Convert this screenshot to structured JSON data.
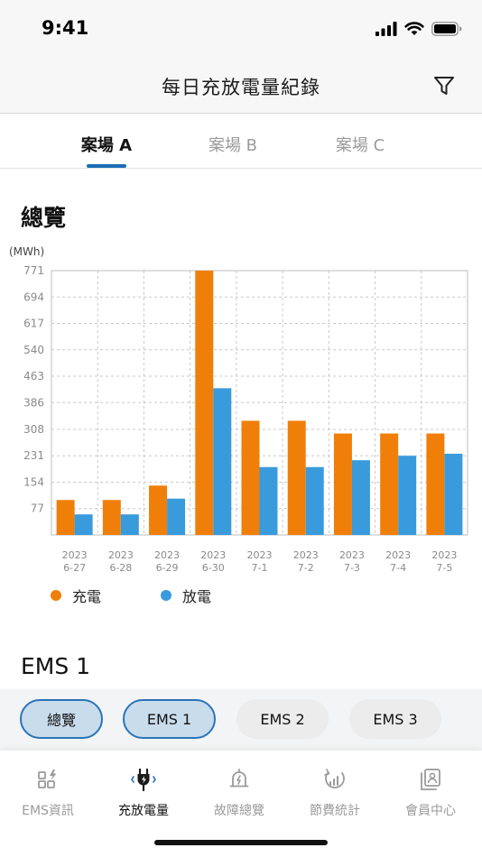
{
  "status_bar": {
    "time": "9:41"
  },
  "nav": {
    "title": "每日充放電量紀錄"
  },
  "site_tabs": [
    {
      "label": "案場 A",
      "active": true
    },
    {
      "label": "案場 B",
      "active": false
    },
    {
      "label": "案場 C",
      "active": false
    }
  ],
  "overview": {
    "title": "總覽"
  },
  "chart_data": {
    "type": "bar",
    "ylabel": "(MWh)",
    "ylim": [
      0,
      771
    ],
    "yticks": [
      "771",
      "694",
      "617",
      "540",
      "463",
      "386",
      "308",
      "231",
      "154",
      "77"
    ],
    "categories": [
      [
        "2023",
        "6-27"
      ],
      [
        "2023",
        "6-28"
      ],
      [
        "2023",
        "6-29"
      ],
      [
        "2023",
        "6-30"
      ],
      [
        "2023",
        "7-1"
      ],
      [
        "2023",
        "7-2"
      ],
      [
        "2023",
        "7-3"
      ],
      [
        "2023",
        "7-4"
      ],
      [
        "2023",
        "7-5"
      ]
    ],
    "series": [
      {
        "name": "充電",
        "color": "#f07f09",
        "values": [
          102,
          102,
          144,
          771,
          333,
          333,
          296,
          296,
          296
        ]
      },
      {
        "name": "放電",
        "color": "#3a9bdc",
        "values": [
          60,
          60,
          106,
          428,
          198,
          198,
          218,
          231,
          237
        ]
      }
    ],
    "grid": true,
    "legend": "bottom-left"
  },
  "ems": {
    "title": "EMS 1",
    "chips": [
      {
        "label": "總覽",
        "selected": true
      },
      {
        "label": "EMS 1",
        "selected": true
      },
      {
        "label": "EMS 2",
        "selected": false
      },
      {
        "label": "EMS 3",
        "selected": false
      }
    ]
  },
  "tab_bar": {
    "items": [
      {
        "label": "EMS資訊",
        "icon": "dashboard-icon",
        "active": false
      },
      {
        "label": "充放電量",
        "icon": "plug-charge-icon",
        "active": true
      },
      {
        "label": "故障總覽",
        "icon": "alarm-bell-icon",
        "active": false
      },
      {
        "label": "節費統計",
        "icon": "savings-chart-icon",
        "active": false
      },
      {
        "label": "會員中心",
        "icon": "member-profile-icon",
        "active": false
      }
    ]
  }
}
